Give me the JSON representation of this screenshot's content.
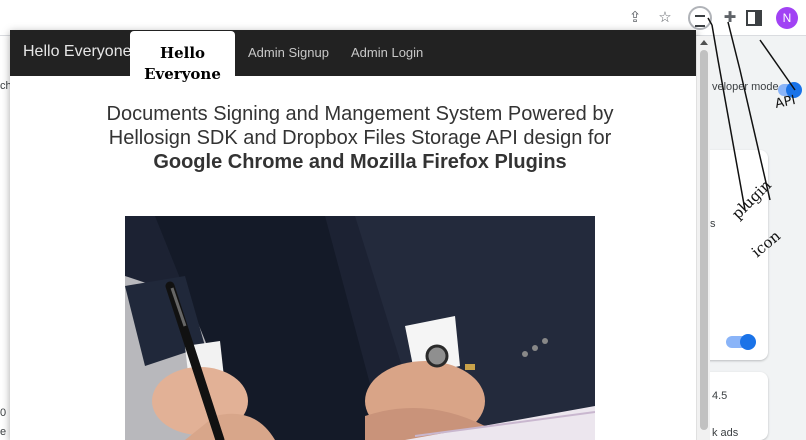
{
  "browser": {
    "avatar_letter": "N",
    "icons": [
      "share-icon",
      "star-icon",
      "extension-icon",
      "puzzle-icon",
      "side-panel-icon"
    ]
  },
  "background_page": {
    "developer_mode_label": "veloper mode",
    "side_texts": [
      "ch",
      "0",
      "e"
    ],
    "version": "4.5",
    "ads_text": "k ads",
    "card_text": "s"
  },
  "popup": {
    "brand": "Hello Everyone",
    "active_tab_line1": "Hello",
    "active_tab_line2": "Everyone",
    "nav_links": [
      "Admin Signup",
      "Admin Login"
    ],
    "headline_line1": "Documents Signing and Mangement System Powered by",
    "headline_line2": "Hellosign SDK and Dropbox Files Storage API design for",
    "headline_bold": "Google Chrome and Mozilla Firefox Plugins"
  },
  "annotations": {
    "api_text": "API",
    "plugin_text": "plugin",
    "icon_text": "icon"
  },
  "colors": {
    "navbar": "#222222",
    "avatar": "#a142f4",
    "toggle": "#1a73e8"
  }
}
